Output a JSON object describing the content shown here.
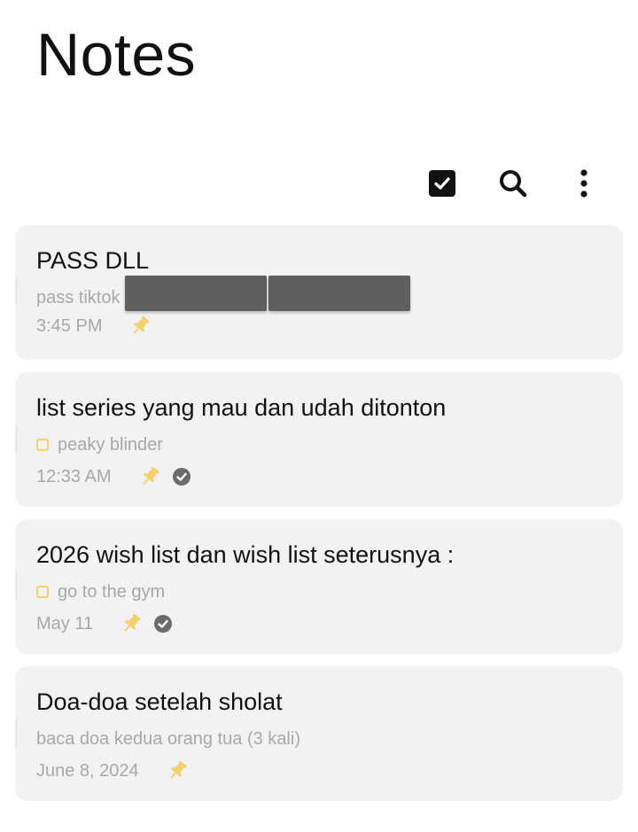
{
  "header": {
    "title": "Notes"
  },
  "toolbar": {
    "icons": [
      "checkbox-icon",
      "search-icon",
      "more-vertical-icon"
    ]
  },
  "colors": {
    "card_background": "#f2f2f2",
    "pin": "#f4cf6a",
    "muted_text": "#a8a8a8",
    "done_badge": "#6b6b6b"
  },
  "notes": [
    {
      "title": "PASS DLL",
      "preview": "pass tiktok",
      "preview_redacted": true,
      "has_checkbox": false,
      "date": "3:45 PM",
      "pinned": true,
      "done_badge": false
    },
    {
      "title": "list series yang mau dan udah ditonton",
      "preview": "peaky blinder",
      "preview_redacted": false,
      "has_checkbox": true,
      "date": "12:33 AM",
      "pinned": true,
      "done_badge": true
    },
    {
      "title": "2026 wish list dan wish list seterusnya :",
      "preview": "go to the gym",
      "preview_redacted": false,
      "has_checkbox": true,
      "date": "May 11",
      "pinned": true,
      "done_badge": true
    },
    {
      "title": "Doa-doa setelah sholat",
      "preview": "baca doa kedua orang tua (3 kali)",
      "preview_redacted": false,
      "has_checkbox": false,
      "date": "June 8, 2024",
      "pinned": true,
      "done_badge": false
    }
  ]
}
